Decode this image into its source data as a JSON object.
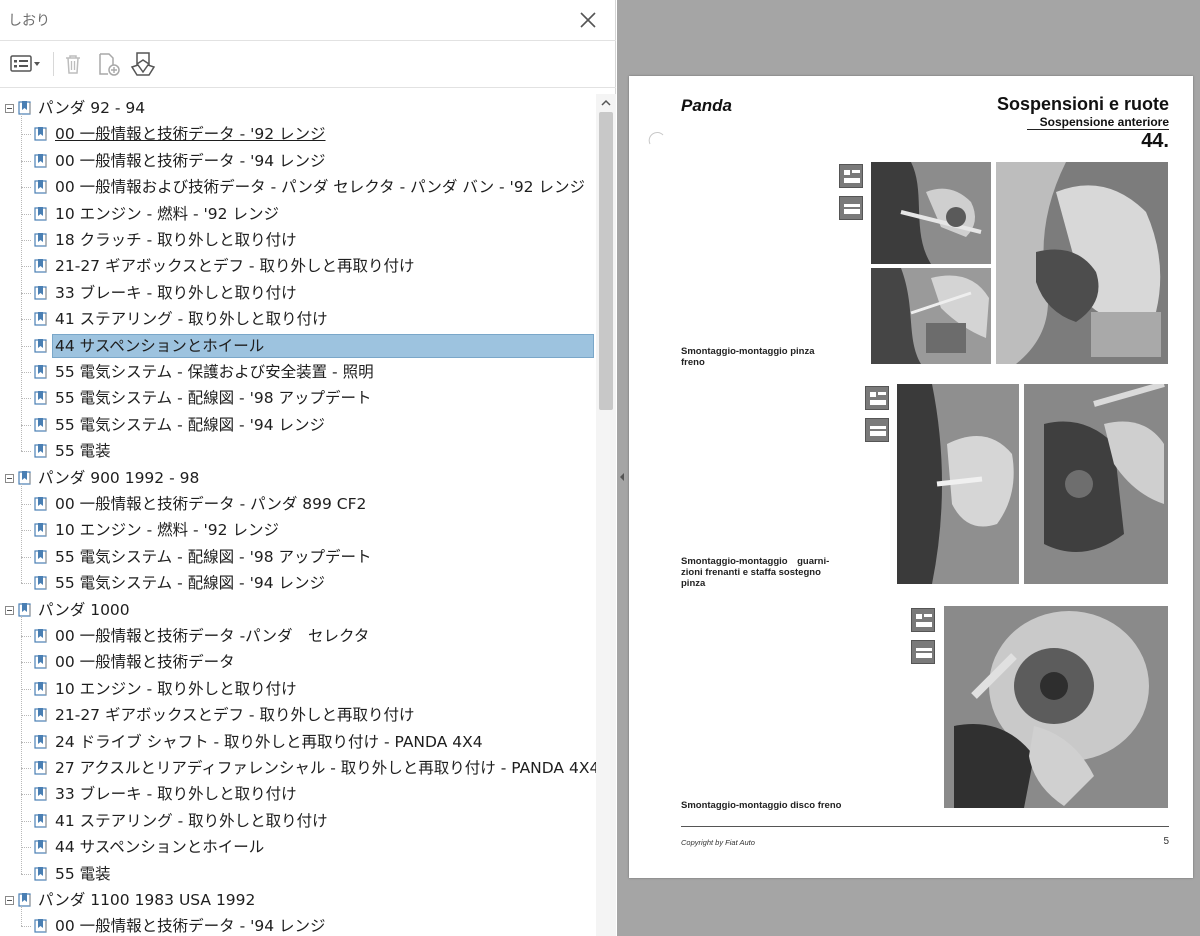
{
  "panel": {
    "title": "しおり",
    "toolbar": {
      "options_icon": "list-options-icon",
      "delete_icon": "trash-icon",
      "new_icon": "new-bookmark-icon",
      "find_icon": "find-bookmark-icon"
    }
  },
  "bookmarks": [
    {
      "label": "パンダ 92 - 94",
      "level": 0
    },
    {
      "label": "00 一般情報と技術データ - '92 レンジ",
      "level": 1,
      "current": true
    },
    {
      "label": "00 一般情報と技術データ - '94 レンジ",
      "level": 1
    },
    {
      "label": "00 一般情報および技術データ - パンダ セレクタ - パンダ バン - '92 レンジ",
      "level": 1
    },
    {
      "label": "10 エンジン - 燃料 - '92 レンジ",
      "level": 1
    },
    {
      "label": "18 クラッチ - 取り外しと取り付け",
      "level": 1
    },
    {
      "label": "21-27 ギアボックスとデフ - 取り外しと再取り付け",
      "level": 1
    },
    {
      "label": "33 ブレーキ - 取り外しと取り付け",
      "level": 1
    },
    {
      "label": "41 ステアリング - 取り外しと取り付け",
      "level": 1
    },
    {
      "label": "44 サスペンションとホイール",
      "level": 1,
      "selected": true
    },
    {
      "label": "55 電気システム - 保護および安全装置 - 照明",
      "level": 1
    },
    {
      "label": "55 電気システム - 配線図 - '98 アップデート",
      "level": 1
    },
    {
      "label": "55 電気システム - 配線図 - '94 レンジ",
      "level": 1
    },
    {
      "label": "55 電装",
      "level": 1
    },
    {
      "label": "パンダ 900 1992 - 98",
      "level": 0
    },
    {
      "label": "00 一般情報と技術データ - パンダ 899 CF2",
      "level": 1
    },
    {
      "label": "10 エンジン - 燃料 - '92 レンジ",
      "level": 1
    },
    {
      "label": "55 電気システム - 配線図 - '98 アップデート",
      "level": 1
    },
    {
      "label": "55 電気システム - 配線図 - '94 レンジ",
      "level": 1
    },
    {
      "label": "パンダ 1000",
      "level": 0
    },
    {
      "label": "00 一般情報と技術データ -パンダ　セレクタ",
      "level": 1
    },
    {
      "label": "00 一般情報と技術データ",
      "level": 1
    },
    {
      "label": "10 エンジン - 取り外しと取り付け",
      "level": 1
    },
    {
      "label": "21-27 ギアボックスとデフ - 取り外しと再取り付け",
      "level": 1
    },
    {
      "label": "24 ドライブ シャフト - 取り外しと再取り付け - PANDA 4X4",
      "level": 1
    },
    {
      "label": "27 アクスルとリアディファレンシャル - 取り外しと再取り付け - PANDA 4X4",
      "level": 1
    },
    {
      "label": "33 ブレーキ - 取り外しと取り付け",
      "level": 1
    },
    {
      "label": "41 ステアリング - 取り外しと取り付け",
      "level": 1
    },
    {
      "label": "44 サスペンションとホイール",
      "level": 1
    },
    {
      "label": "55 電装",
      "level": 1
    },
    {
      "label": "パンダ 1100 1983 USA 1992",
      "level": 0
    },
    {
      "label": "00 一般情報と技術データ - '94 レンジ",
      "level": 1
    }
  ],
  "document": {
    "brand": "Panda",
    "section": "Sospensioni e ruote",
    "subsection": "Sospensione anteriore",
    "number": "44.",
    "captions": [
      "Smontaggio-montaggio pinza freno",
      "Smontaggio-montaggio　guarni-zioni frenanti e staffa sostegno pinza",
      "Smontaggio-montaggio disco freno"
    ],
    "copyright": "Copyright by Fiat Auto",
    "page_number": "5"
  },
  "colors": {
    "selection": "#9dc3df",
    "viewer_bg": "#a5a5a5",
    "bookmark_icon": "#4a7fb3"
  }
}
